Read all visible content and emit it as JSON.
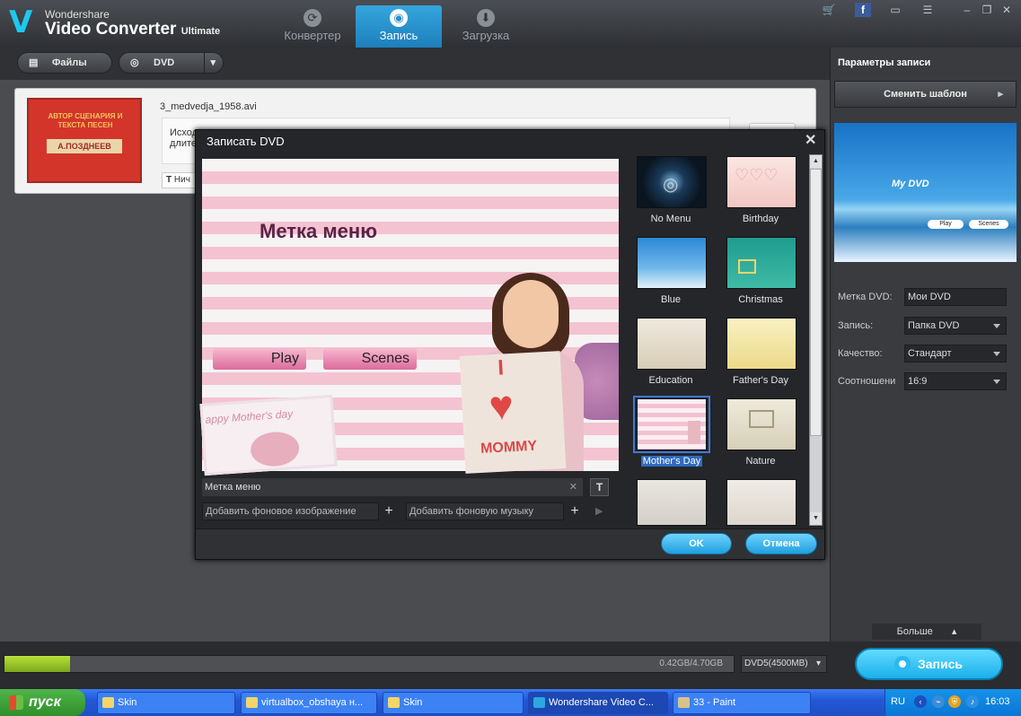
{
  "app": {
    "brand": "Wondershare",
    "product": "Video Converter",
    "edition": "Ultimate",
    "tabs": [
      {
        "label": "Конвертер",
        "icon": "convert-icon"
      },
      {
        "label": "Запись",
        "icon": "burn-disc-icon",
        "active": true
      },
      {
        "label": "Загрузка",
        "icon": "download-icon"
      }
    ]
  },
  "toolbar": {
    "files_label": "Файлы",
    "dvd_label": "DVD"
  },
  "file": {
    "name": "3_medvedja_1958.avi",
    "meta_line1": "Исход...",
    "meta_line2": "длите...",
    "subtitle_chip": "Нич",
    "thumb_text": "АВТОР СЦЕНАРИЯ И ТЕКСТА ПЕСЕН",
    "thumb_name": "А.ПОЗДНЕЕВ"
  },
  "right_panel": {
    "title": "Параметры записи",
    "change_template": "Сменить шаблон",
    "preview": {
      "title": "My DVD",
      "play": "Play",
      "scenes": "Scenes"
    },
    "fields": [
      {
        "label": "Метка DVD:",
        "value": "Мои DVD",
        "type": "input"
      },
      {
        "label": "Запись:",
        "value": "Папка DVD",
        "type": "select"
      },
      {
        "label": "Качество:",
        "value": "Стандарт",
        "type": "select"
      },
      {
        "label": "Соотношени",
        "value": "16:9",
        "type": "select"
      }
    ],
    "more": "Больше"
  },
  "bottom": {
    "progress": 0.09,
    "size_label": "0.42GB/4.70GB",
    "dvd_select": "DVD5(4500MB)",
    "burn_label": "Запись"
  },
  "dialog": {
    "title": "Записать DVD",
    "preview": {
      "menu_title": "Метка меню",
      "play": "Play",
      "scenes": "Scenes",
      "card_i": "I",
      "card_word": "MOMMY",
      "frame_text": "appy Mother's day"
    },
    "menu_label_value": "Метка меню",
    "add_bg_image": "Добавить фоновое изображение",
    "add_bg_music": "Добавить фоновую музыку",
    "templates": [
      "No Menu",
      "Birthday",
      "Blue",
      "Christmas",
      "Education",
      "Father's Day",
      "Mother's Day",
      "Nature",
      "",
      ""
    ],
    "selected_template": "Mother's Day",
    "ok": "OK",
    "cancel": "Отмена"
  },
  "taskbar": {
    "start": "пуск",
    "tasks": [
      {
        "label": "Skin"
      },
      {
        "label": "virtualbox_obshaya н..."
      },
      {
        "label": "Skin"
      },
      {
        "label": "Wondershare Video C...",
        "active": true
      },
      {
        "label": "33 - Paint"
      }
    ],
    "lang": "RU",
    "clock": "16:03"
  },
  "colors": {
    "accent": "#1ea7e4",
    "selected": "#3d79d5",
    "progress": "#8fbf22"
  }
}
